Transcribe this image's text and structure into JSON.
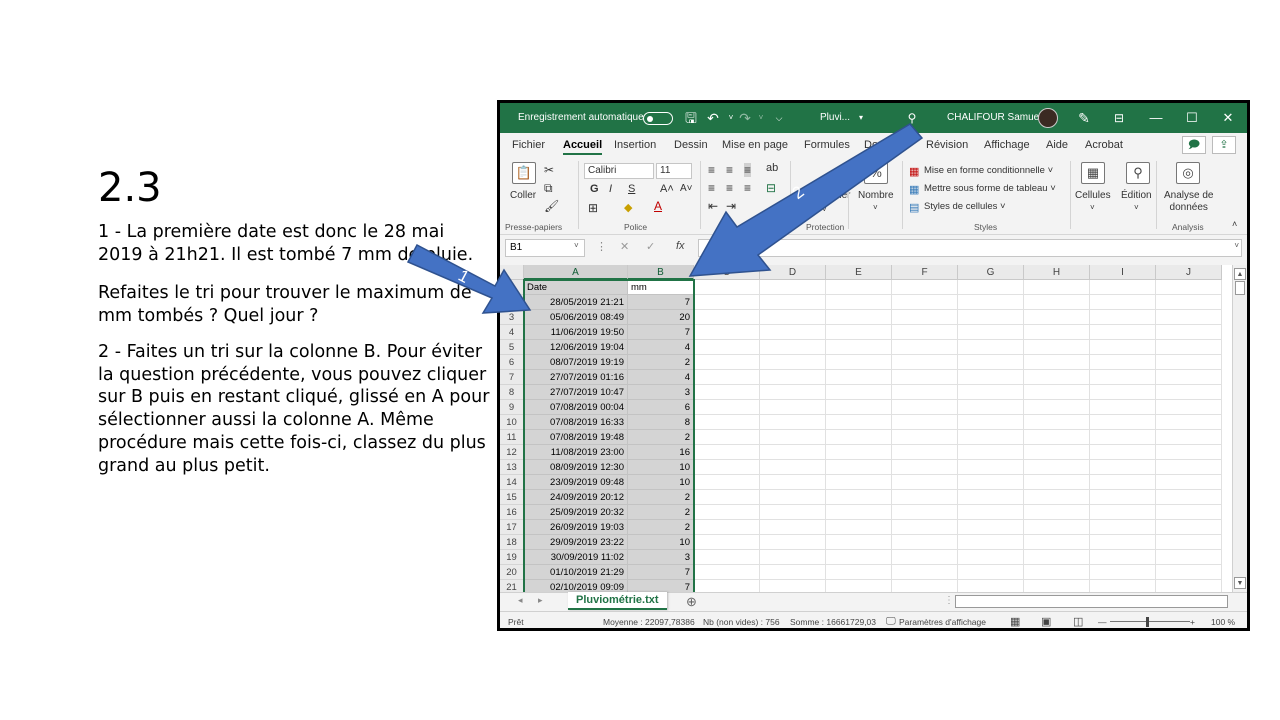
{
  "slide": {
    "title": "2.3",
    "p1": "1 - La première date est donc le 28 mai 2019 à 21h21. Il est tombé 7 mm de pluie.",
    "p2": "Refaites le tri pour trouver le maximum de mm tombés ? Quel jour ?",
    "p3": "2 - Faites un tri sur la colonne B. Pour éviter la question précédente, vous pouvez cliquer sur B puis en restant cliqué, glissé en A pour sélectionner aussi la colonne A. Même procédure mais cette fois-ci, classez du plus grand au plus petit.",
    "arrow1_label": "1",
    "arrow2_label": "2",
    "arrow_color": "#4472c4"
  },
  "excel": {
    "accent": "#217346",
    "titlebar": {
      "autosave": "Enregistrement automatique",
      "filename": "Pluvi...",
      "user": "CHALIFOUR Samuel",
      "save_icon": "save-icon",
      "undo_icon": "undo-icon",
      "redo_icon": "redo-icon",
      "search_icon": "search-icon"
    },
    "menu": [
      "Fichier",
      "Accueil",
      "Insertion",
      "Dessin",
      "Mise en page",
      "Formules",
      "Données",
      "Révision",
      "Affichage",
      "Aide",
      "Acrobat"
    ],
    "ribbon": {
      "paste": "Coller",
      "font_name": "Calibri",
      "font_size": "11",
      "bold": "G",
      "italic": "I",
      "underline": "S",
      "grow": "A˄",
      "shrink": "A˅",
      "merge": "Fusionner",
      "number": "Nombre",
      "cond_format": "Mise en forme conditionnelle ˅",
      "table_format": "Mettre sous forme de tableau ˅",
      "cell_styles": "Styles de cellules ˅",
      "cells": "Cellules",
      "edition": "Édition",
      "analysis": "Analyse de\ndonnées",
      "groups": [
        "Presse-papiers",
        "Police",
        "Protection",
        "Styles",
        "Analysis"
      ]
    },
    "formula": {
      "namebox": "B1",
      "fx": "fx"
    },
    "columns": [
      "A",
      "B",
      "C",
      "D",
      "E",
      "F",
      "G",
      "H",
      "I",
      "J"
    ],
    "rows": [
      {
        "n": "1",
        "a": "Date",
        "b": "mm"
      },
      {
        "n": "2",
        "a": "28/05/2019 21:21",
        "b": "7"
      },
      {
        "n": "3",
        "a": "05/06/2019 08:49",
        "b": "20"
      },
      {
        "n": "4",
        "a": "11/06/2019 19:50",
        "b": "7"
      },
      {
        "n": "5",
        "a": "12/06/2019 19:04",
        "b": "4"
      },
      {
        "n": "6",
        "a": "08/07/2019 19:19",
        "b": "2"
      },
      {
        "n": "7",
        "a": "27/07/2019 01:16",
        "b": "4"
      },
      {
        "n": "8",
        "a": "27/07/2019 10:47",
        "b": "3"
      },
      {
        "n": "9",
        "a": "07/08/2019 00:04",
        "b": "6"
      },
      {
        "n": "10",
        "a": "07/08/2019 16:33",
        "b": "8"
      },
      {
        "n": "11",
        "a": "07/08/2019 19:48",
        "b": "2"
      },
      {
        "n": "12",
        "a": "11/08/2019 23:00",
        "b": "16"
      },
      {
        "n": "13",
        "a": "08/09/2019 12:30",
        "b": "10"
      },
      {
        "n": "14",
        "a": "23/09/2019 09:48",
        "b": "10"
      },
      {
        "n": "15",
        "a": "24/09/2019 20:12",
        "b": "2"
      },
      {
        "n": "16",
        "a": "25/09/2019 20:32",
        "b": "2"
      },
      {
        "n": "17",
        "a": "26/09/2019 19:03",
        "b": "2"
      },
      {
        "n": "18",
        "a": "29/09/2019 23:22",
        "b": "10"
      },
      {
        "n": "19",
        "a": "30/09/2019 11:02",
        "b": "3"
      },
      {
        "n": "20",
        "a": "01/10/2019 21:29",
        "b": "7"
      },
      {
        "n": "21",
        "a": "02/10/2019 09:09",
        "b": "7"
      }
    ],
    "sheet_tab": "Pluviométrie.txt",
    "status": {
      "ready": "Prêt",
      "average": "Moyenne : 22097,78386",
      "count": "Nb (non vides) : 756",
      "sum": "Somme : 16661729,03",
      "display_settings": "Paramètres d'affichage",
      "zoom": "100 %"
    }
  }
}
